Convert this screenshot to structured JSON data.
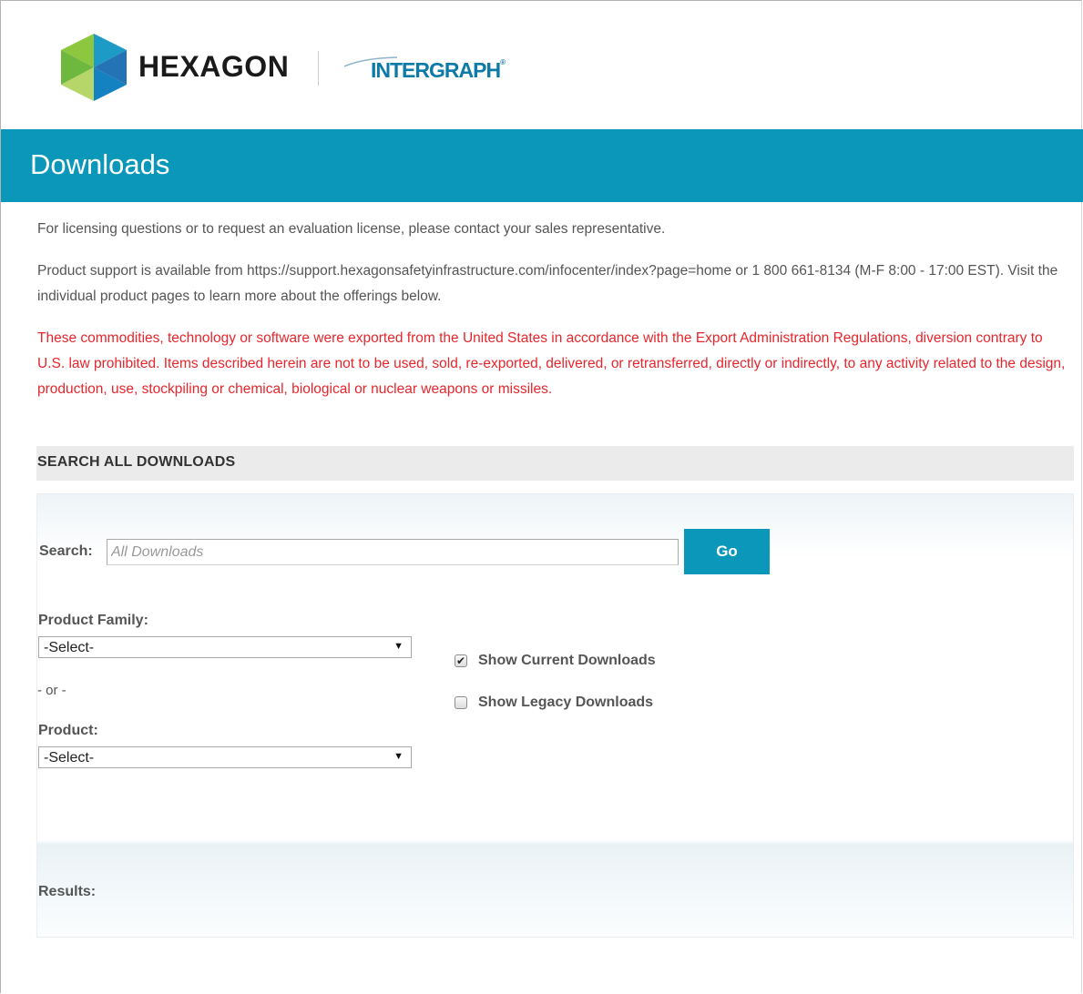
{
  "header": {
    "hexagon_wordmark": "HEXAGON",
    "intergraph_wordmark": "INTERGRAPH",
    "intergraph_tm": "®"
  },
  "banner": {
    "title": "Downloads"
  },
  "intro": {
    "licensing": "For licensing questions or to request an evaluation license, please contact your sales representative.",
    "support": "Product support is available from https://support.hexagonsafetyinfrastructure.com/infocenter/index?page=home or 1 800 661-8134 (M-F 8:00 - 17:00 EST). Visit the individual product pages to learn more about the offerings below.",
    "export_notice": "These commodities, technology or software were exported from the United States in accordance with the Export Administration Regulations, diversion contrary to U.S. law prohibited. Items described herein are not to be used, sold, re-exported, delivered, or retransferred, directly or indirectly, to any activity related to the design, production, use, stockpiling or chemical, biological or nuclear weapons or missiles."
  },
  "search": {
    "section_title": "SEARCH ALL DOWNLOADS",
    "label": "Search:",
    "placeholder": "All Downloads",
    "value": "",
    "go_label": "Go",
    "product_family_label": "Product Family:",
    "product_family_selected": "-Select-",
    "or_text": "- or -",
    "product_label": "Product:",
    "product_selected": "-Select-",
    "show_current_label": "Show Current Downloads",
    "show_current_checked": true,
    "show_legacy_label": "Show Legacy Downloads",
    "show_legacy_checked": false,
    "results_label": "Results:"
  },
  "colors": {
    "brand_blue": "#0a97ba",
    "notice_red": "#e6262c",
    "hex_green": "#8dc63f",
    "hex_teal": "#1b9bc6"
  },
  "icons": {
    "select_arrow": "▼",
    "checkmark": "✔"
  }
}
